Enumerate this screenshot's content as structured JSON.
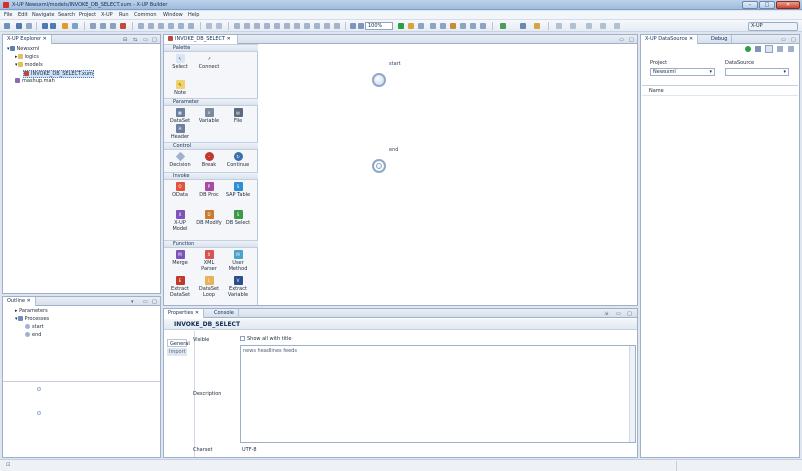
{
  "window": {
    "title": "X-UP  Newsxml/models/INVOKE_DB_SELECT.xum - X-UP Builder",
    "buttons": {
      "minimize": "–",
      "maximize": "□",
      "close": "✕"
    }
  },
  "menu": [
    "File",
    "Edit",
    "Navigate",
    "Search",
    "Project",
    "X-UP",
    "Run",
    "Common",
    "Window",
    "Help"
  ],
  "toolbar": {
    "zoom": "100%",
    "perspective_label": "X-UP"
  },
  "explorer": {
    "tab_label": "X-UP Explorer",
    "tree": [
      {
        "label": "Newsxml",
        "level": 0,
        "icon": "project-icon"
      },
      {
        "label": "logics",
        "level": 1,
        "icon": "folder-icon"
      },
      {
        "label": "models",
        "level": 1,
        "icon": "folder-icon"
      },
      {
        "label": "INVOKE_DB_SELECT.xum",
        "level": 2,
        "icon": "model-file-icon",
        "selected": true
      },
      {
        "label": "mashup.mah",
        "level": 1,
        "icon": "mashup-file-icon"
      }
    ]
  },
  "outline": {
    "tab_label": "Outline",
    "tree": [
      {
        "label": "Parameters",
        "level": 0
      },
      {
        "label": "Processes",
        "level": 0
      },
      {
        "label": "start",
        "level": 1
      },
      {
        "label": "end",
        "level": 1
      }
    ]
  },
  "editor": {
    "tab_label": "INVOKE_DB_SELECT",
    "palette": {
      "title": "Palette",
      "top_tools": [
        {
          "label": "Select",
          "icon": "arrow-icon"
        },
        {
          "label": "Connect",
          "icon": "connect-icon"
        },
        {
          "label": "Note",
          "icon": "note-icon"
        }
      ],
      "sections": [
        {
          "title": "Parameter",
          "items": [
            {
              "label": "DataSet",
              "color": "#6b7f9e"
            },
            {
              "label": "Variable",
              "color": "#7c8aa0"
            },
            {
              "label": "File",
              "color": "#5d6b80"
            },
            {
              "label": "Header",
              "color": "#6b7f9e"
            }
          ]
        },
        {
          "title": "Control",
          "items": [
            {
              "label": "Decision",
              "color": "#9fb3d0"
            },
            {
              "label": "Break",
              "color": "#c0392b"
            },
            {
              "label": "Continue",
              "color": "#3a6fb0"
            }
          ]
        },
        {
          "title": "Invoke",
          "items": [
            {
              "label": "OData",
              "color": "#e0533d"
            },
            {
              "label": "DB Proc",
              "color": "#a64ca6"
            },
            {
              "label": "SAP Table",
              "color": "#2d8fd5"
            },
            {
              "label": "X-UP Model",
              "color": "#7d55b8"
            },
            {
              "label": "DB Modify",
              "color": "#c97b2e"
            },
            {
              "label": "DB Select",
              "color": "#3d9a47"
            }
          ]
        },
        {
          "title": "Function",
          "items": [
            {
              "label": "Merge",
              "color": "#7d55b8"
            },
            {
              "label": "XML Parser",
              "color": "#d9534f"
            },
            {
              "label": "User Method",
              "color": "#4aa3c9"
            },
            {
              "label": "Extract DataSet",
              "color": "#c0392b"
            },
            {
              "label": "DataSet Loop",
              "color": "#e6b35a"
            },
            {
              "label": "Extract Variable",
              "color": "#2c4f8c"
            }
          ]
        }
      ]
    },
    "nodes": [
      {
        "label": "start"
      },
      {
        "label": "end"
      }
    ]
  },
  "properties": {
    "tab_label": "Properties",
    "console_tab_label": "Console",
    "heading": "INVOKE_DB_SELECT",
    "side_tabs": [
      "General",
      "Import"
    ],
    "rows": {
      "visible_label": "Visible",
      "show_all_label": "Show all with title",
      "description_label": "Description",
      "description_value": "news headlines feeds",
      "charset_label": "Charset",
      "charset_value": "UTF-8"
    }
  },
  "datasource": {
    "tab_label": "X-UP DataSource",
    "debug_tab_label": "Debug",
    "project_label": "Project",
    "project_value": "Newsxml",
    "datasource_label": "DataSource",
    "datasource_value": "",
    "list_header": "Name"
  },
  "status": {
    "text": "⊡"
  }
}
